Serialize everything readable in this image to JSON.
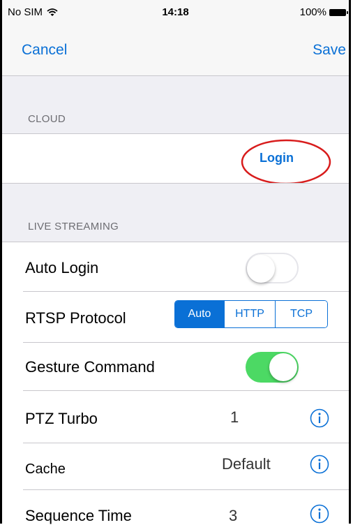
{
  "status_bar": {
    "carrier": "No SIM",
    "time": "14:18",
    "battery": "100%"
  },
  "nav": {
    "cancel_label": "Cancel",
    "save_label": "Save"
  },
  "cloud": {
    "header": "CLOUD",
    "login_label": "Login"
  },
  "live_streaming": {
    "header": "LIVE STREAMING",
    "auto_login": {
      "label": "Auto Login",
      "state": "off"
    },
    "rtsp_protocol": {
      "label": "RTSP Protocol",
      "options": [
        "Auto",
        "HTTP",
        "TCP"
      ],
      "selected": "Auto"
    },
    "gesture_command": {
      "label": "Gesture Command",
      "state": "on"
    },
    "ptz_turbo": {
      "label": "PTZ Turbo",
      "value": "1"
    },
    "cache": {
      "label": "Cache",
      "value": "Default"
    },
    "sequence_time": {
      "label": "Sequence Time",
      "value": "3"
    }
  },
  "icons": {
    "wifi": "wifi-icon",
    "battery": "battery-icon",
    "info": "info-icon"
  },
  "colors": {
    "accent": "#0a70d6",
    "toggle_on": "#4cd964",
    "annotation": "#d81c1c",
    "group_background": "#efeff4"
  }
}
